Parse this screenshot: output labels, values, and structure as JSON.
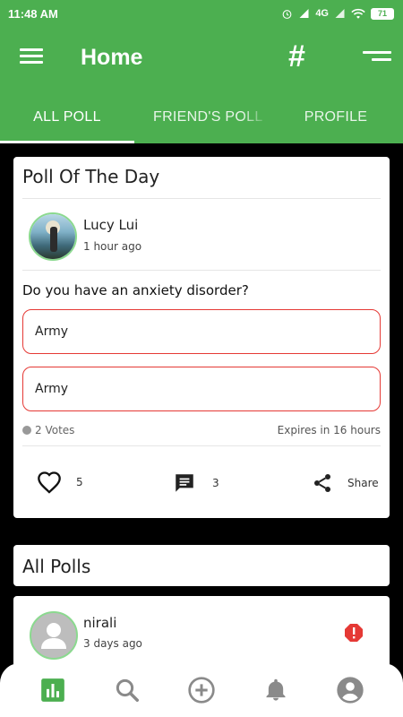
{
  "status": {
    "time": "11:48 AM",
    "network": "4G",
    "battery": "71"
  },
  "app_bar": {
    "title": "Home",
    "hash_label": "#"
  },
  "tabs": [
    {
      "label": "ALL POLL",
      "active": true
    },
    {
      "label": "FRIEND'S POLL",
      "active": false
    },
    {
      "label": "PROFILE",
      "active": false
    }
  ],
  "poll_of_day": {
    "heading": "Poll Of The Day",
    "author": "Lucy Lui",
    "time": "1 hour ago",
    "question": "Do you have an anxiety disorder?",
    "options": [
      "Army",
      "Army"
    ],
    "votes": "2 Votes",
    "expires": "Expires in 16 hours",
    "likes": "5",
    "comments": "3",
    "share_label": "Share"
  },
  "all_polls": {
    "heading": "All Polls",
    "items": [
      {
        "author": "nirali",
        "time": "3 days ago"
      }
    ]
  },
  "colors": {
    "primary": "#4caf50",
    "option_border": "#e53935",
    "report": "#e53935",
    "avatar_ring": "#8bd98f"
  },
  "bottom_nav": [
    "poll-chart-icon",
    "search-icon",
    "add-circle-icon",
    "bell-icon",
    "account-icon"
  ]
}
